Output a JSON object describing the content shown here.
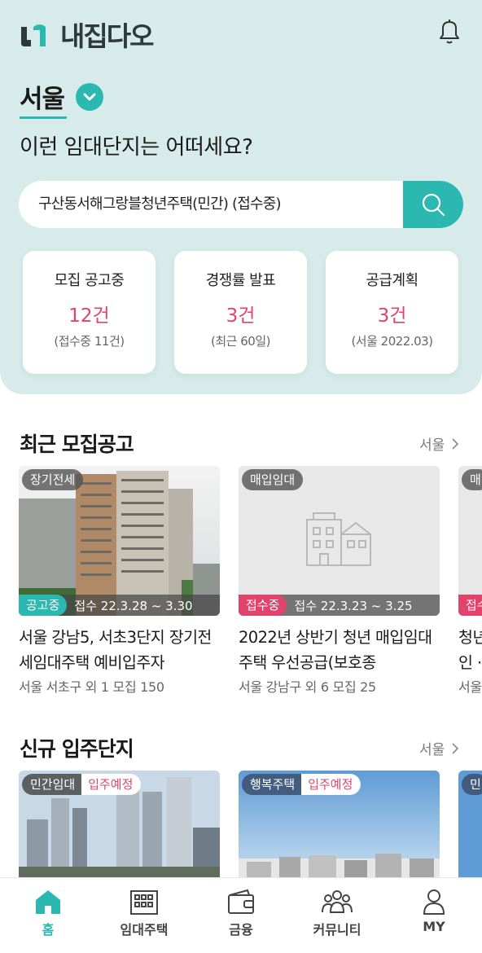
{
  "header": {
    "logo_text": "내집다오",
    "notification_icon": "bell-icon"
  },
  "region": {
    "label": "서울",
    "toggle_icon": "chevron-down-icon"
  },
  "question": "이런 임대단지는 어떠세요?",
  "search": {
    "value": "구산동서해그랑블청년주택(민간) (접수중)",
    "icon": "search-icon"
  },
  "stats": [
    {
      "title": "모집 공고중",
      "value": "12건",
      "sub": "(접수중 11건)"
    },
    {
      "title": "경쟁률 발표",
      "value": "3건",
      "sub": "(최근 60일)"
    },
    {
      "title": "공급계획",
      "value": "3건",
      "sub": "(서울 2022.03)"
    }
  ],
  "recent": {
    "title": "최근 모집공고",
    "more": "서울",
    "cards": [
      {
        "type_tag": "장기전세",
        "status": "공고중",
        "period": "접수 22.3.28 ~ 3.30",
        "title": "서울 강남5, 서초3단지 장기전세임대주택 예비입주자",
        "meta": "서울 서초구 외 1  모집 150"
      },
      {
        "type_tag": "매입임대",
        "status": "접수중",
        "period": "접수 22.3.23 ~ 3.25",
        "title": "2022년 상반기 청년 매입임대주택 우선공급(보호종",
        "meta": "서울 강남구 외 6  모집 25"
      },
      {
        "type_tag": "매",
        "status": "접수",
        "title": "청년 인 ·",
        "meta": "서울"
      }
    ]
  },
  "newcomplex": {
    "title": "신규 입주단지",
    "more": "서울",
    "cards": [
      {
        "type_tag": "민간임대",
        "status": "입주예정"
      },
      {
        "type_tag": "행복주택",
        "status": "입주예정"
      },
      {
        "type_tag": "민"
      }
    ]
  },
  "colors": {
    "accent": "#2bb8b1",
    "highlight": "#e2436d",
    "hero_bg": "#d7ecea"
  },
  "tabs": [
    {
      "label": "홈",
      "icon": "home-icon",
      "active": true
    },
    {
      "label": "임대주택",
      "icon": "building-icon"
    },
    {
      "label": "금융",
      "icon": "wallet-icon"
    },
    {
      "label": "커뮤니티",
      "icon": "people-icon"
    },
    {
      "label": "MY",
      "icon": "person-icon"
    }
  ]
}
